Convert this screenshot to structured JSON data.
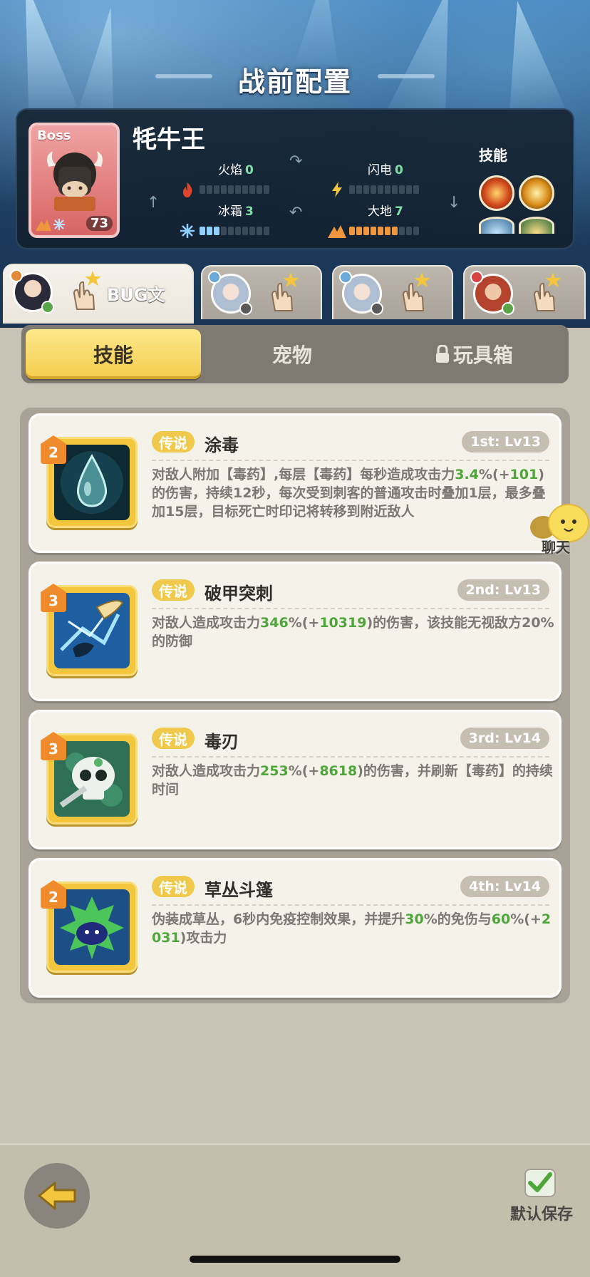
{
  "header": {
    "title": "战前配置"
  },
  "boss": {
    "tag": "Boss",
    "name": "牦牛王",
    "level": "73",
    "skills_label": "技能",
    "elements": {
      "fire": {
        "label": "火焰",
        "value": "0",
        "level": 0
      },
      "lightning": {
        "label": "闪电",
        "value": "0",
        "level": 0
      },
      "frost": {
        "label": "冰霜",
        "value": "3",
        "level": 3
      },
      "earth": {
        "label": "大地",
        "value": "7",
        "level": 7
      }
    }
  },
  "heroes": [
    {
      "name": "BUG文",
      "active": true
    },
    {
      "name": "",
      "active": false
    },
    {
      "name": "",
      "active": false
    },
    {
      "name": "",
      "active": false
    }
  ],
  "categories": {
    "skills": "技能",
    "pets": "宠物",
    "toybox": "玩具箱"
  },
  "skills": [
    {
      "stars": "2",
      "rarity": "传说",
      "name": "涂毒",
      "slot": "1st: Lv13",
      "desc": [
        {
          "t": "对敌人附加【毒药】,每层【毒药】每秒造成攻击力"
        },
        {
          "t": "3.4",
          "hl": true
        },
        {
          "t": "%(+"
        },
        {
          "t": "101",
          "hl": true
        },
        {
          "t": ")的伤害，持续12秒，每次受到刺客的普通攻击时叠加1层，最多叠加15层，目标死亡时印记将转移到附近敌人"
        }
      ]
    },
    {
      "stars": "3",
      "rarity": "传说",
      "name": "破甲突刺",
      "slot": "2nd: Lv13",
      "desc": [
        {
          "t": "对敌人造成攻击力"
        },
        {
          "t": "346",
          "hl": true
        },
        {
          "t": "%(+"
        },
        {
          "t": "10319",
          "hl": true
        },
        {
          "t": ")的伤害，该技能无视敌方20%的防御"
        }
      ]
    },
    {
      "stars": "3",
      "rarity": "传说",
      "name": "毒刃",
      "slot": "3rd: Lv14",
      "desc": [
        {
          "t": "对敌人造成攻击力"
        },
        {
          "t": "253",
          "hl": true
        },
        {
          "t": "%(+"
        },
        {
          "t": "8618",
          "hl": true
        },
        {
          "t": ")的伤害，并刷新【毒药】的持续时间"
        }
      ]
    },
    {
      "stars": "2",
      "rarity": "传说",
      "name": "草丛斗篷",
      "slot": "4th: Lv14",
      "desc": [
        {
          "t": "伪装成草丛，6秒内免疫控制效果，并提升"
        },
        {
          "t": "30",
          "hl": true
        },
        {
          "t": "%的免伤与"
        },
        {
          "t": "60",
          "hl": true
        },
        {
          "t": "%(+"
        },
        {
          "t": "2031",
          "hl": true
        },
        {
          "t": ")攻击力"
        }
      ]
    }
  ],
  "chat": {
    "label": "聊天"
  },
  "footer": {
    "save_label": "默认保存"
  },
  "colors": {
    "highlight": "#4ea63a",
    "rarity": "#f0c94a",
    "active_tab": "#f4cd4d"
  }
}
